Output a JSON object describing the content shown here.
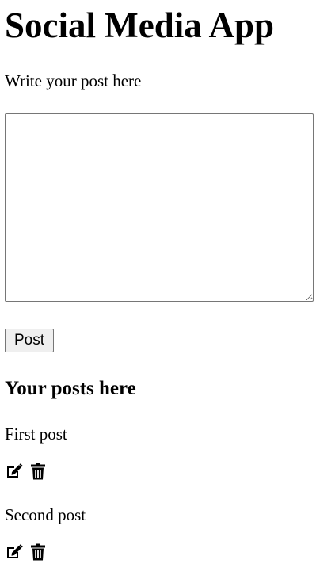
{
  "app": {
    "title": "Social Media App"
  },
  "composer": {
    "label": "Write your post here",
    "value": "",
    "placeholder": "",
    "post_button_label": "Post"
  },
  "posts_section": {
    "heading": "Your posts here",
    "posts": [
      {
        "text": "First post",
        "edit_icon": "edit-icon",
        "delete_icon": "trash-icon"
      },
      {
        "text": "Second post",
        "edit_icon": "edit-icon",
        "delete_icon": "trash-icon"
      }
    ]
  },
  "colors": {
    "text": "#000000",
    "button_bg": "#efefef",
    "border": "#767676"
  }
}
